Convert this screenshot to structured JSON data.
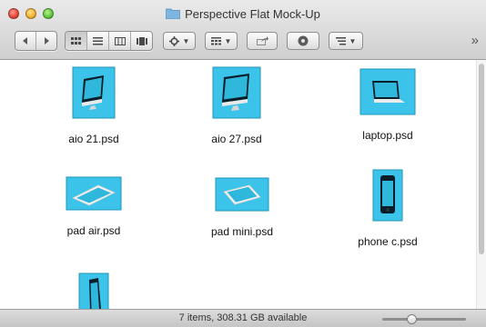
{
  "window": {
    "title": "Perspective Flat Mock-Up",
    "accent": "#3cc3ea"
  },
  "toolbar": {
    "back_icon": "chevron-left-icon",
    "forward_icon": "chevron-right-icon",
    "view_icons": [
      "icon-view-icon",
      "list-view-icon",
      "column-view-icon",
      "coverflow-view-icon"
    ],
    "action_icon": "gear-icon",
    "arrange_icon": "arrange-icon",
    "share_icon": "share-icon",
    "quicklook_icon": "eye-icon",
    "sort_icon": "sort-icon",
    "overflow_label": "»"
  },
  "files": [
    {
      "name": "aio 21.psd",
      "kind": "aio"
    },
    {
      "name": "aio 27.psd",
      "kind": "aio"
    },
    {
      "name": "laptop.psd",
      "kind": "laptop"
    },
    {
      "name": "pad air.psd",
      "kind": "pad"
    },
    {
      "name": "pad mini.psd",
      "kind": "pad"
    },
    {
      "name": "phone c.psd",
      "kind": "phone"
    },
    {
      "name": "",
      "kind": "phone"
    }
  ],
  "status": {
    "text": "7 items, 308.31 GB available",
    "zoom_level": 0.35
  }
}
